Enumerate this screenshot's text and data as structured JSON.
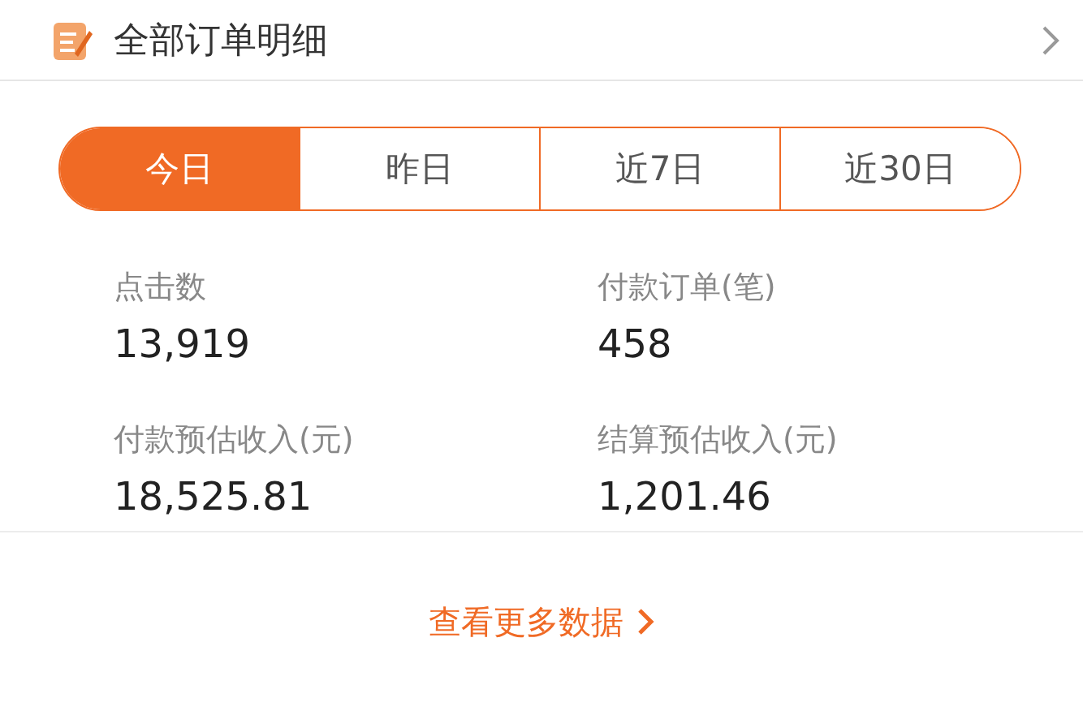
{
  "header": {
    "title": "全部订单明细"
  },
  "tabs": [
    {
      "label": "今日",
      "selected": true
    },
    {
      "label": "昨日",
      "selected": false
    },
    {
      "label": "近7日",
      "selected": false
    },
    {
      "label": "近30日",
      "selected": false
    }
  ],
  "stats": [
    {
      "label": "点击数",
      "value": "13,919"
    },
    {
      "label": "付款订单(笔)",
      "value": "458"
    },
    {
      "label": "付款预估收入(元)",
      "value": "18,525.81"
    },
    {
      "label": "结算预估收入(元)",
      "value": "1,201.46"
    }
  ],
  "more_link": {
    "label": "查看更多数据"
  }
}
